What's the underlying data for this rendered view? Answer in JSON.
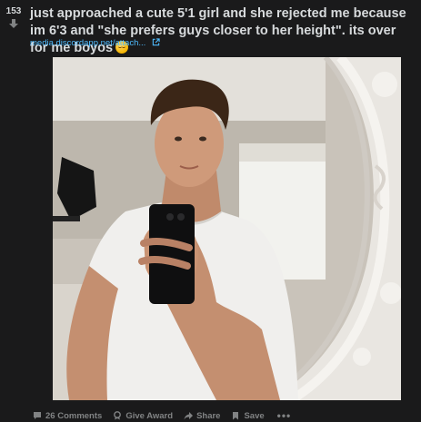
{
  "post": {
    "score": "153",
    "title": "just approached a cute 5'1 girl and she rejected me because im 6'3 and \"she prefers guys closer to her height\". its over for me boyos",
    "emoji_icon": "pensive-emoji",
    "link_text": "media.discordapp.net/attach...",
    "image_description_icon": "photo"
  },
  "actions": {
    "comments": "26 Comments",
    "give_award": "Give Award",
    "share": "Share",
    "save": "Save",
    "more": "•••"
  },
  "colors": {
    "background": "#1a1a1b",
    "text": "#d7dadc",
    "link": "#4fbcff",
    "muted": "#818384"
  }
}
